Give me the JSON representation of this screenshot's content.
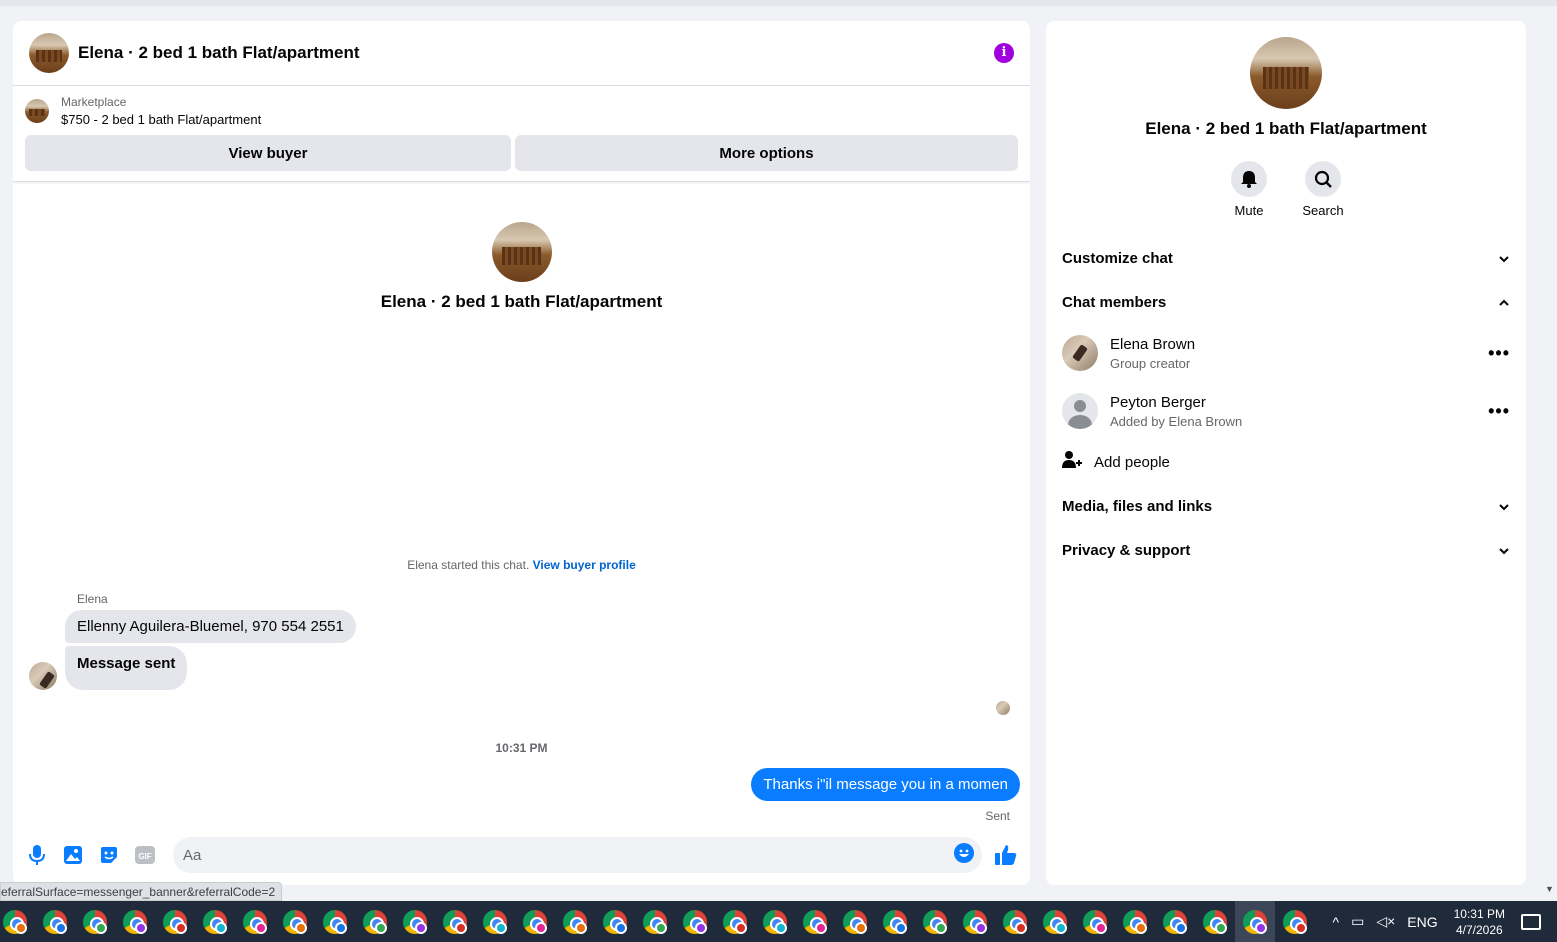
{
  "chat": {
    "title": "Elena · 2 bed 1 bath Flat/apartment",
    "marketplace_label": "Marketplace",
    "listing": "$750 - 2 bed 1 bath Flat/apartment",
    "view_buyer": "View buyer",
    "more_options": "More options",
    "hero_title": "Elena · 2 bed 1 bath Flat/apartment",
    "started_text": "Elena started this chat.",
    "view_buyer_profile": "View buyer profile",
    "sender_name": "Elena",
    "messages_in": [
      "Ellenny Aguilera-Bluemel, 970 554 2551",
      "Message sent"
    ],
    "timestamp": "10:31 PM",
    "message_out": "Thanks i\"il message you in a momen",
    "sent_status": "Sent",
    "composer_placeholder": "Aa",
    "composer_icons": [
      "microphone-icon",
      "photo-icon",
      "sticker-icon",
      "gif-icon"
    ],
    "gif_label": "GIF"
  },
  "status_url": "eferralSurface=messenger_banner&referralCode=2",
  "info": {
    "title": "Elena · 2 bed 1 bath Flat/apartment",
    "actions": [
      {
        "label": "Mute",
        "icon": "bell-icon"
      },
      {
        "label": "Search",
        "icon": "search-icon"
      }
    ],
    "customize_chat": "Customize chat",
    "chat_members": "Chat members",
    "members": [
      {
        "name": "Elena Brown",
        "sub": "Group creator"
      },
      {
        "name": "Peyton Berger",
        "sub": "Added by Elena Brown"
      }
    ],
    "add_people": "Add people",
    "media": "Media, files and links",
    "privacy": "Privacy & support"
  },
  "taskbar": {
    "language": "ENG",
    "time": "10:31 PM",
    "date": "4/7/2026",
    "badge_colors": [
      "#e8710a",
      "#1a73e8",
      "#34a853",
      "#9334e6",
      "#d93025",
      "#12b5cb",
      "#e52592"
    ]
  },
  "colors": {
    "accent": "#0a7cff",
    "link": "#0064d1",
    "info_icon": "#a000e0"
  }
}
